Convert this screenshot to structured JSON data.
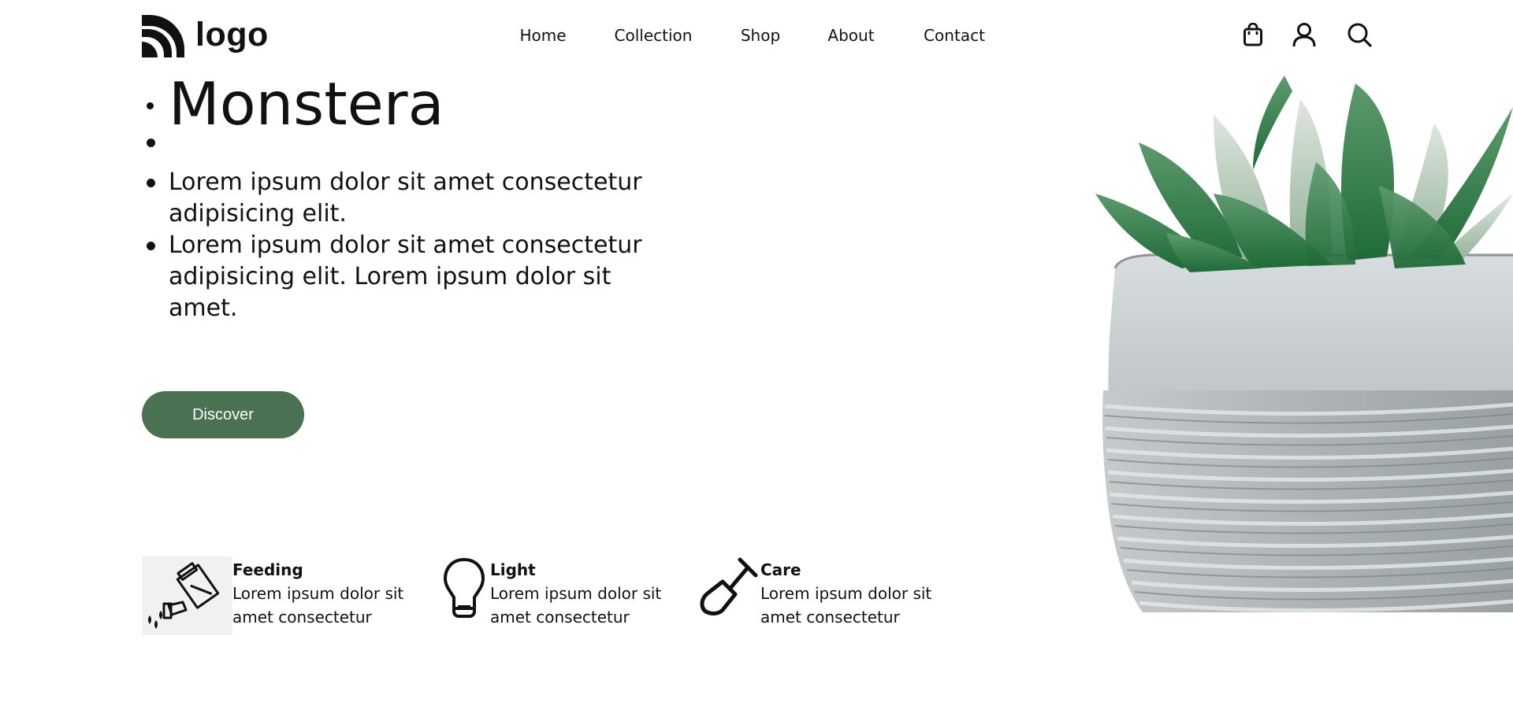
{
  "logo": {
    "text": "logo",
    "icon": "logo-mark-icon"
  },
  "nav": {
    "items": [
      {
        "label": "Home"
      },
      {
        "label": "Collection"
      },
      {
        "label": "Shop"
      },
      {
        "label": "About"
      },
      {
        "label": "Contact"
      }
    ]
  },
  "header_icons": [
    "shopping-bag-icon",
    "user-icon",
    "search-icon"
  ],
  "hero": {
    "title": "Monstera",
    "paragraphs": [
      "Lorem ipsum dolor sit amet consectetur adipisicing elit.",
      "Lorem ipsum dolor sit amet consectetur adipisicing elit. Lorem ipsum dolor sit amet."
    ],
    "button_label": "Discover"
  },
  "features": [
    {
      "name": "Feeding",
      "description": "Lorem ipsum dolor sit amet consectetur",
      "icon": "watering-can-icon"
    },
    {
      "name": "Light",
      "description": "Lorem ipsum dolor sit amet consectetur",
      "icon": "light-bulb-icon"
    },
    {
      "name": "Care",
      "description": "Lorem ipsum dolor sit amet consectetur",
      "icon": "shovel-icon"
    }
  ],
  "colors": {
    "accent": "#4a7151",
    "text": "#111111",
    "background": "#ffffff",
    "plant_green": "#2f7a45",
    "pot_gray": "#c9ced0"
  }
}
